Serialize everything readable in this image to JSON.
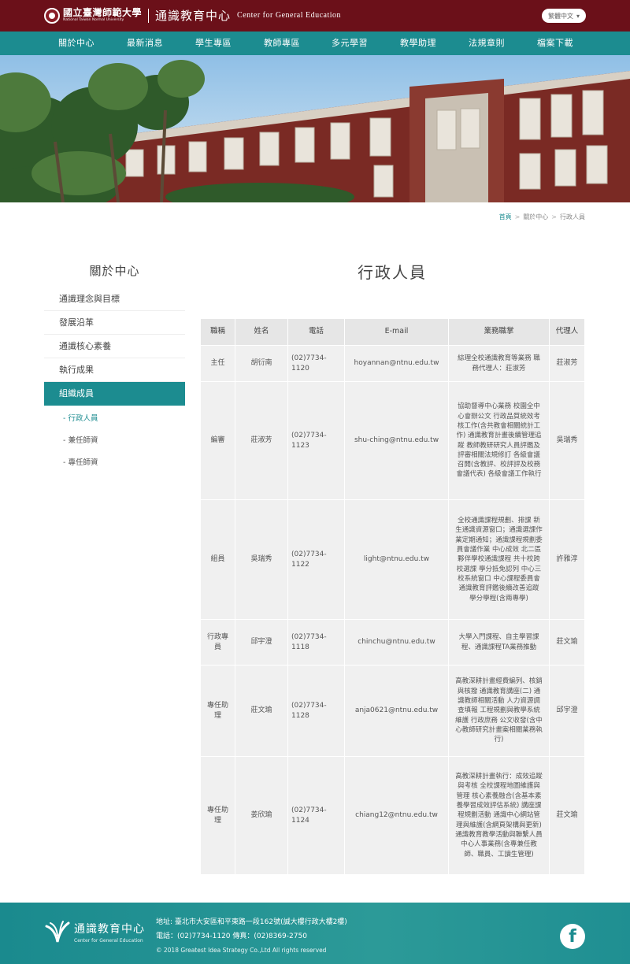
{
  "header": {
    "university_zh": "國立臺灣師範大學",
    "university_en": "National Taiwan Normal University",
    "center_zh": "通識教育中心",
    "center_en": "Center for General Education",
    "language_select": "繁體中文"
  },
  "nav": [
    "關於中心",
    "最新消息",
    "學生專區",
    "教師專區",
    "多元學習",
    "教學助理",
    "法規章則",
    "檔案下載"
  ],
  "breadcrumb": [
    "首頁",
    "關於中心",
    "行政人員"
  ],
  "sidebar": {
    "title": "關於中心",
    "items": [
      "通識理念與目標",
      "發展沿革",
      "通識核心素養",
      "執行成果",
      "組織成員"
    ],
    "subitems": [
      "行政人員",
      "兼任師資",
      "專任師資"
    ]
  },
  "main": {
    "title": "行政人員",
    "table": {
      "headers": [
        "職稱",
        "姓名",
        "電話",
        "E-mail",
        "業務職掌",
        "代理人"
      ],
      "rows": [
        {
          "title": "主任",
          "name": "胡衍南",
          "phone": "(02)7734-1120",
          "email": "hoyannan@ntnu.edu.tw",
          "duty": "綜理全校通識教育等業務 職務代理人：莊淑芳",
          "proxy": "莊淑芳"
        },
        {
          "title": "編審",
          "name": "莊淑芳",
          "phone": "(02)7734-1123",
          "email": "shu-ching@ntnu.edu.tw",
          "duty": "協助督導中心業務 校園全中心會辦公文 行政品質統效考核工作(含共教會相關統計工作) 通識教育計畫後續管理追蹤 教師教研研究人員評鑑及評審相關法規修訂 各級會議召開(含教評、校評評及校務會議代表) 各級會議工作執行",
          "proxy": "吳瑞秀"
        },
        {
          "title": "組員",
          "name": "吳瑞秀",
          "phone": "(02)7734-1122",
          "email": "light@ntnu.edu.tw",
          "duty": "全校通識課程規劃、排課 新生通識資源窗口；通識選課作業定期通知；通識課程規劃委員會議作業 中心成效 北二區夥伴學校通識課程 共十校跨校選課 學分抵免認列 中心三校系統窗口 中心課程委員會 通識教育評鑑後續改善追蹤 學分學程(含兩專學)",
          "proxy": "許雅淳"
        },
        {
          "title": "行政專員",
          "name": "邱宇澄",
          "phone": "(02)7734-1118",
          "email": "chinchu@ntnu.edu.tw",
          "duty": "大學入門課程、自主學習課程、通識課程TA業務推動",
          "proxy": "莊文瑜"
        },
        {
          "title": "專任助理",
          "name": "莊文瑜",
          "phone": "(02)7734-1128",
          "email": "anja0621@ntnu.edu.tw",
          "duty": "高教深耕計畫經費編列、核銷與核撥 通識教育講座(二) 通識教師相關活動 人力資源調查填報 工程規劃與教學系統維護 行政庶務 公文收發(含中心教師研究計畫案相關業務執行)",
          "proxy": "邱宇澄"
        },
        {
          "title": "專任助理",
          "name": "姜欣瑜",
          "phone": "(02)7734-1124",
          "email": "chiang12@ntnu.edu.tw",
          "duty": "高教深耕計畫執行：成效追蹤與考核 全校課程地圖維護與管理 核心素養融合(含基本素養學習成效評估系統) 講座課程規劃活動 通識中心網站管理與維護(含網頁架構與更新) 通識教育教學活動與聯繫人員 中心人事業務(含專兼任教師、職員、工讀生管理)",
          "proxy": "莊文瑜"
        }
      ]
    }
  },
  "footer": {
    "logo_zh": "通識教育中心",
    "logo_en": "Center for General Education",
    "address": "地址: 臺北市大安區和平東路一段162號(誠大樓行政大樓2樓)",
    "contact": "電話：(02)7734-1120    傳真：(02)8369-2750",
    "copyright": "© 2018 Greatest Idea Strategy Co.,Ltd All rights reserved",
    "social_icon": "facebook-icon"
  },
  "colors": {
    "maroon": "#6b1019",
    "teal": "#1c8c90"
  }
}
